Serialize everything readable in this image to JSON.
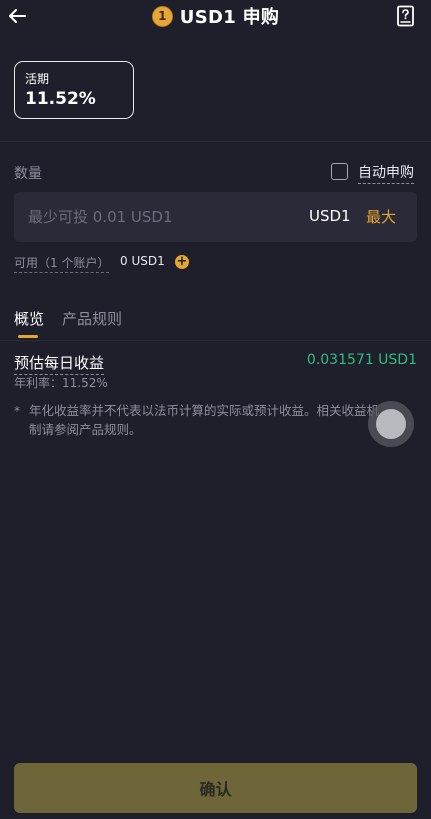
{
  "header": {
    "back_icon": "arrow-left-icon",
    "coin_badge": "1",
    "title": "USD1 申购",
    "doc_icon": "document-help-icon"
  },
  "term": {
    "label": "活期",
    "rate": "11.52%"
  },
  "quantity": {
    "label": "数量",
    "auto_label": "自动申购",
    "auto_checked": false,
    "placeholder": "最少可投 0.01 USD1",
    "value": "",
    "unit": "USD1",
    "max_label": "最大"
  },
  "available": {
    "label": "可用（1 个账户）",
    "value": "0 USD1",
    "add_icon": "plus-circle-icon"
  },
  "tabs": [
    {
      "label": "概览",
      "active": true
    },
    {
      "label": "产品规则",
      "active": false
    }
  ],
  "estimate": {
    "label": "预估每日收益",
    "value": "0.031571 USD1",
    "apr": "年利率：11.52%"
  },
  "note": {
    "star": "*",
    "text": "年化收益率并不代表以法币计算的实际或预计收益。相关收益机制请参阅产品规则。"
  },
  "confirm_label": "确认",
  "colors": {
    "background": "#1f1e2b",
    "accent": "#e3a72f",
    "positive": "#2ebd85",
    "confirm_disabled": "#6e6638"
  }
}
